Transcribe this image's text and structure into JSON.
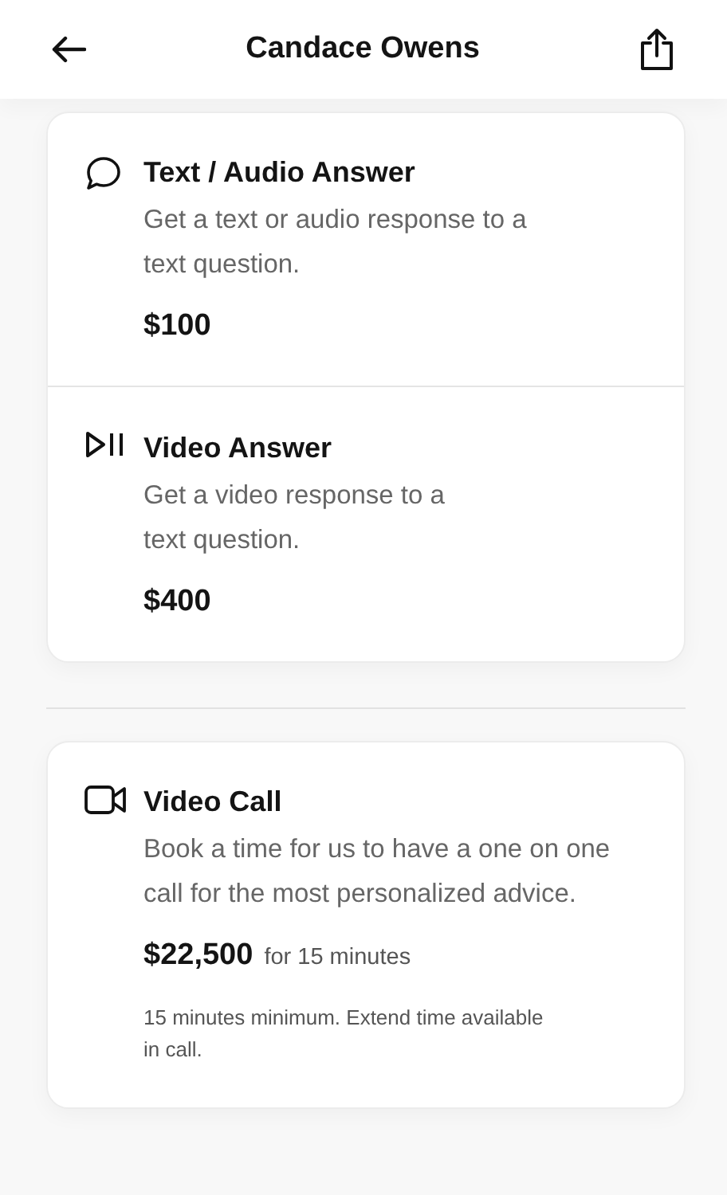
{
  "header": {
    "title": "Candace Owens"
  },
  "groups": [
    {
      "options": [
        {
          "kind": "text",
          "title": "Text / Audio Answer",
          "description_lines": [
            "Get a text or audio response to a",
            "text question."
          ],
          "price": "$100"
        },
        {
          "kind": "video",
          "title": "Video Answer",
          "description_lines": [
            "Get a video response to a",
            "text question."
          ],
          "price": "$400"
        }
      ]
    },
    {
      "options": [
        {
          "kind": "call",
          "title": "Video Call",
          "description_lines": [
            "Book a time for us to have a one on one",
            "call for the most personalized advice."
          ],
          "price": "$22,500",
          "price_note": "for 15 minutes",
          "note_lines": [
            "15 minutes minimum. Extend time available",
            "in call."
          ]
        }
      ]
    }
  ]
}
